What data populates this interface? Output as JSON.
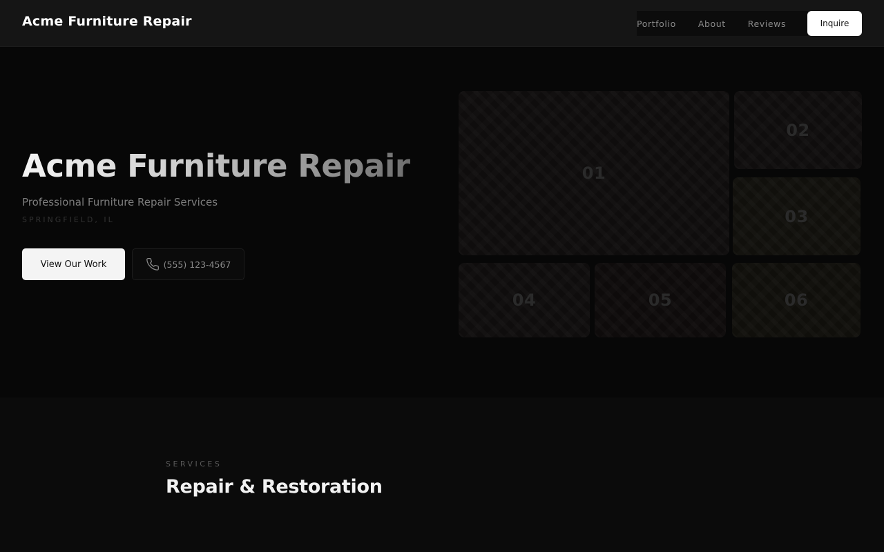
{
  "header": {
    "brand": "Acme Furniture Repair",
    "nav": [
      {
        "label": "Portfolio"
      },
      {
        "label": "About"
      },
      {
        "label": "Reviews"
      }
    ],
    "cta_label": "Inquire"
  },
  "hero": {
    "title": "Acme Furniture Repair",
    "subtitle": "Professional Furniture Repair Services",
    "location": "SPRINGFIELD, IL",
    "primary_button": "View Our Work",
    "phone_button": "(555) 123-4567",
    "phone_icon": "phone-icon"
  },
  "gallery": {
    "tiles": [
      {
        "label": "01"
      },
      {
        "label": "02"
      },
      {
        "label": "03"
      },
      {
        "label": "04"
      },
      {
        "label": "05"
      },
      {
        "label": "06"
      }
    ]
  },
  "services": {
    "label": "SERVICES",
    "title": "Repair & Restoration"
  },
  "colors": {
    "background": "#0a0a0a",
    "header": "#151515",
    "accent_button": "#ffffff",
    "muted_text": "#8a8a8a"
  }
}
